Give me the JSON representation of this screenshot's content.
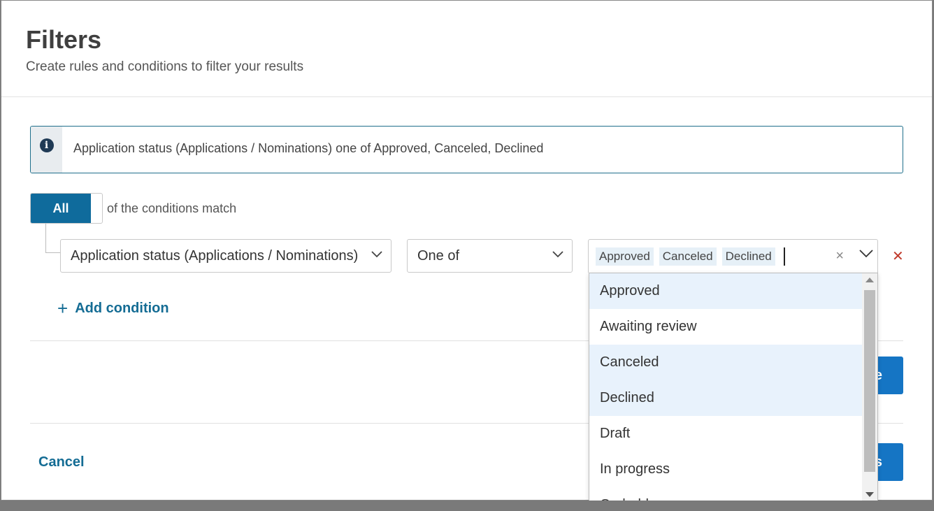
{
  "header": {
    "title": "Filters",
    "subtitle": "Create rules and conditions to filter your results"
  },
  "info": {
    "icon": "info-icon",
    "text": "Application status (Applications / Nominations) one of Approved, Canceled, Declined"
  },
  "match": {
    "toggle_label": "All",
    "text": "of the conditions match"
  },
  "condition": {
    "field": "Application status (Applications / Nominations)",
    "operator": "One of",
    "selected_values": [
      "Approved",
      "Canceled",
      "Declined"
    ]
  },
  "add_condition_label": "Add condition",
  "cancel_label": "Cancel",
  "dropdown": {
    "options": [
      {
        "label": "Approved",
        "selected": true
      },
      {
        "label": "Awaiting review",
        "selected": false
      },
      {
        "label": "Canceled",
        "selected": true
      },
      {
        "label": "Declined",
        "selected": true
      },
      {
        "label": "Draft",
        "selected": false
      },
      {
        "label": "In progress",
        "selected": false
      },
      {
        "label": "On hold",
        "selected": false
      }
    ]
  },
  "colors": {
    "primary": "#0f6b9c",
    "button": "#1575c4",
    "link": "#146c94",
    "remove": "#c0392b",
    "selected_option_bg": "#e8f2fc"
  }
}
